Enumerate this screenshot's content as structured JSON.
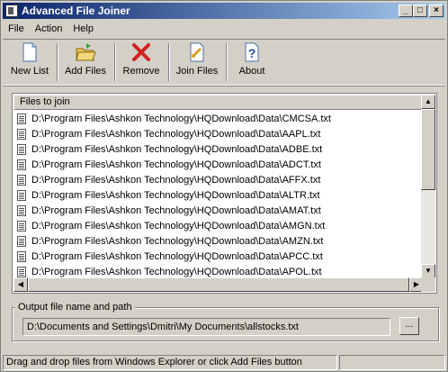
{
  "window": {
    "title": "Advanced File Joiner"
  },
  "menu": [
    "File",
    "Action",
    "Help"
  ],
  "toolbar": {
    "new_list": "New List",
    "add_files": "Add Files",
    "remove": "Remove",
    "join_files": "Join Files",
    "about": "About"
  },
  "list": {
    "header": "Files to join",
    "rows": [
      "D:\\Program Files\\Ashkon Technology\\HQDownload\\Data\\CMCSA.txt",
      "D:\\Program Files\\Ashkon Technology\\HQDownload\\Data\\AAPL.txt",
      "D:\\Program Files\\Ashkon Technology\\HQDownload\\Data\\ADBE.txt",
      "D:\\Program Files\\Ashkon Technology\\HQDownload\\Data\\ADCT.txt",
      "D:\\Program Files\\Ashkon Technology\\HQDownload\\Data\\AFFX.txt",
      "D:\\Program Files\\Ashkon Technology\\HQDownload\\Data\\ALTR.txt",
      "D:\\Program Files\\Ashkon Technology\\HQDownload\\Data\\AMAT.txt",
      "D:\\Program Files\\Ashkon Technology\\HQDownload\\Data\\AMGN.txt",
      "D:\\Program Files\\Ashkon Technology\\HQDownload\\Data\\AMZN.txt",
      "D:\\Program Files\\Ashkon Technology\\HQDownload\\Data\\APCC.txt",
      "D:\\Program Files\\Ashkon Technology\\HQDownload\\Data\\APOL.txt"
    ]
  },
  "output": {
    "label": "Output file name and path",
    "value": "D:\\Documents and Settings\\Dmitri\\My Documents\\allstocks.txt",
    "browse": "..."
  },
  "status": {
    "message": "Drag and drop files from Windows Explorer or click Add Files button",
    "pane2": ""
  }
}
